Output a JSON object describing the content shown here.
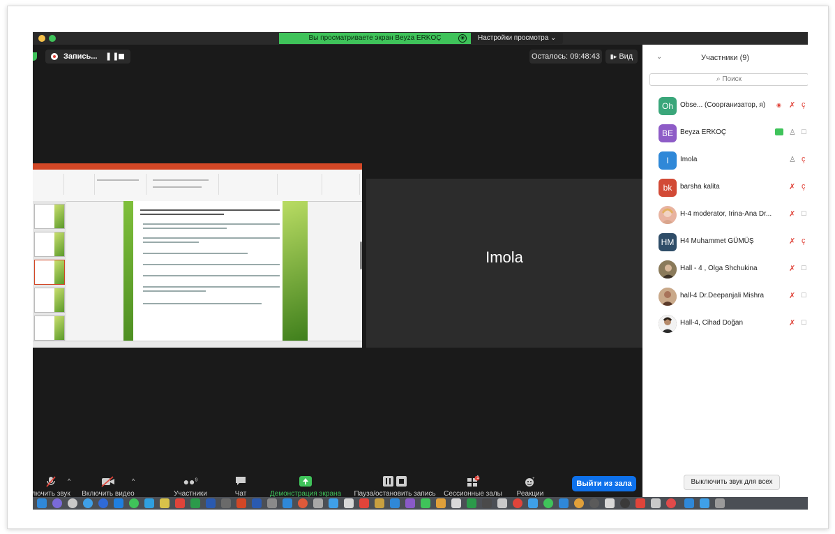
{
  "banner": {
    "sharing_text": "Вы просматриваете экран Beyza ERKOÇ",
    "view_settings": "Настройки просмотра ⌄"
  },
  "recording": {
    "label": "Запись...",
    "pause": "❚❚"
  },
  "timer": "Осталось: 09:48:43",
  "view_button": "Вид",
  "active_speaker": "Imola",
  "toolbar": {
    "audio": "лючить звук",
    "video": "Включить видео",
    "participants": "Участники",
    "participants_count": "9",
    "chat": "Чат",
    "share": "Демонстрация экрана",
    "record": "Пауза/остановить запись",
    "breakout": "Сессионные залы",
    "breakout_badge": "1",
    "reactions": "Реакции",
    "leave": "Выйти из зала"
  },
  "panel": {
    "title": "Участники (9)",
    "search_placeholder": "Поиск",
    "mute_all": "Выключить звук для всех",
    "participants": [
      {
        "initials": "Oh",
        "name": "Obse... (Соорганизатор, я)",
        "color": "#3aa67a"
      },
      {
        "initials": "BE",
        "name": "Beyza ERKOÇ",
        "color": "#8e5cc7"
      },
      {
        "initials": "I",
        "name": "Imola",
        "color": "#2f88d8"
      },
      {
        "initials": "bk",
        "name": "barsha kalita",
        "color": "#d24a36"
      },
      {
        "initials": "",
        "name": "H-4 moderator, Irina-Ana Dr...",
        "color": "#e8b3a0"
      },
      {
        "initials": "HM",
        "name": "H4 Muhammet GÜMÜŞ",
        "color": "#2f4d68"
      },
      {
        "initials": "",
        "name": "Hall - 4 ,  Olga Shchukina",
        "color": "#7a6a4a"
      },
      {
        "initials": "",
        "name": "hall-4 Dr.Deepanjali Mishra",
        "color": "#b98a6a"
      },
      {
        "initials": "",
        "name": "Hall-4, Cihad Doğan",
        "color": "#4a4036"
      }
    ]
  },
  "colors": {
    "banner_green": "#3fc35a",
    "leave_blue": "#0e71eb",
    "muted_red": "#e0443a",
    "recording_red": "#e0443a"
  },
  "icons": {
    "search": "magnifier",
    "mic_muted": "crossed-mic",
    "video_muted": "crossed-camera"
  }
}
